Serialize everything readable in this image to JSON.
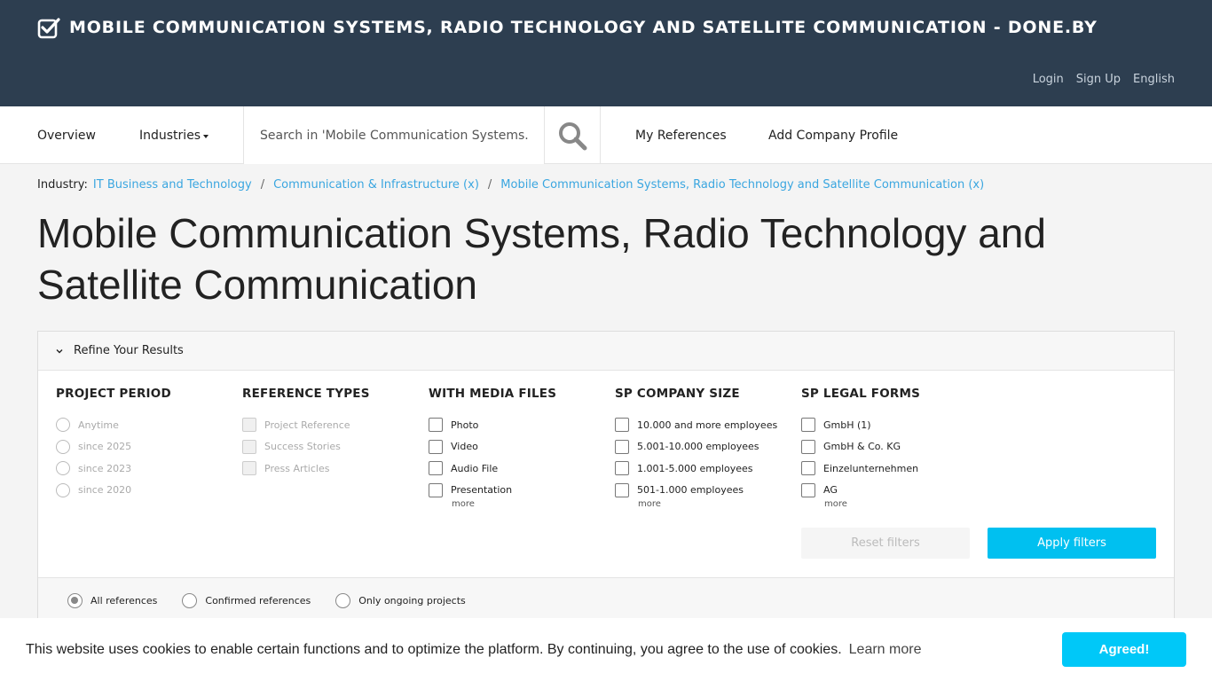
{
  "header": {
    "title": "MOBILE COMMUNICATION SYSTEMS, RADIO TECHNOLOGY AND SATELLITE COMMUNICATION - DONE.BY",
    "brand_icon": "checkbox-check-icon",
    "links": {
      "login": "Login",
      "signup": "Sign Up",
      "language": "English"
    }
  },
  "nav": {
    "overview": "Overview",
    "industries": "Industries",
    "search_placeholder": "Search in 'Mobile Communication Systems...",
    "search_icon": "search-icon",
    "my_references": "My References",
    "add_company": "Add Company Profile"
  },
  "breadcrumb": {
    "label": "Industry:",
    "items": [
      "IT Business and Technology",
      "Communication & Infrastructure (x)",
      "Mobile Communication Systems, Radio Technology and Satellite Communication (x)"
    ],
    "separator": "/"
  },
  "page_title": "Mobile Communication Systems, Radio Technology and Satellite Communication",
  "filters": {
    "panel_title": "Refine Your Results",
    "project_period": {
      "title": "PROJECT PERIOD",
      "options": [
        "Anytime",
        "since 2025",
        "since 2023",
        "since 2020"
      ]
    },
    "reference_types": {
      "title": "REFERENCE TYPES",
      "options": [
        "Project Reference",
        "Success Stories",
        "Press Articles"
      ]
    },
    "media_files": {
      "title": "WITH MEDIA FILES",
      "options": [
        "Photo",
        "Video",
        "Audio File",
        "Presentation"
      ],
      "more": "more"
    },
    "company_size": {
      "title": "SP COMPANY SIZE",
      "options": [
        "10.000 and more employees",
        "5.001-10.000 employees",
        "1.001-5.000 employees",
        "501-1.000 employees"
      ],
      "more": "more"
    },
    "legal_forms": {
      "title": "SP LEGAL FORMS",
      "options": [
        "GmbH (1)",
        "GmbH & Co. KG",
        "Einzelunternehmen",
        "AG"
      ],
      "more": "more"
    },
    "reset": "Reset filters",
    "apply": "Apply filters",
    "reference_scope": {
      "options": [
        "All references",
        "Confirmed references",
        "Only ongoing projects"
      ],
      "selected": "All references"
    }
  },
  "cookie": {
    "text": "This website uses cookies to enable certain functions and to optimize the platform. By continuing, you agree to the use of cookies.",
    "link": "Learn more",
    "button": "Agreed!"
  },
  "colors": {
    "header_bg": "#2d3e50",
    "link": "#3aa6e0",
    "accent": "#00c0f0"
  }
}
